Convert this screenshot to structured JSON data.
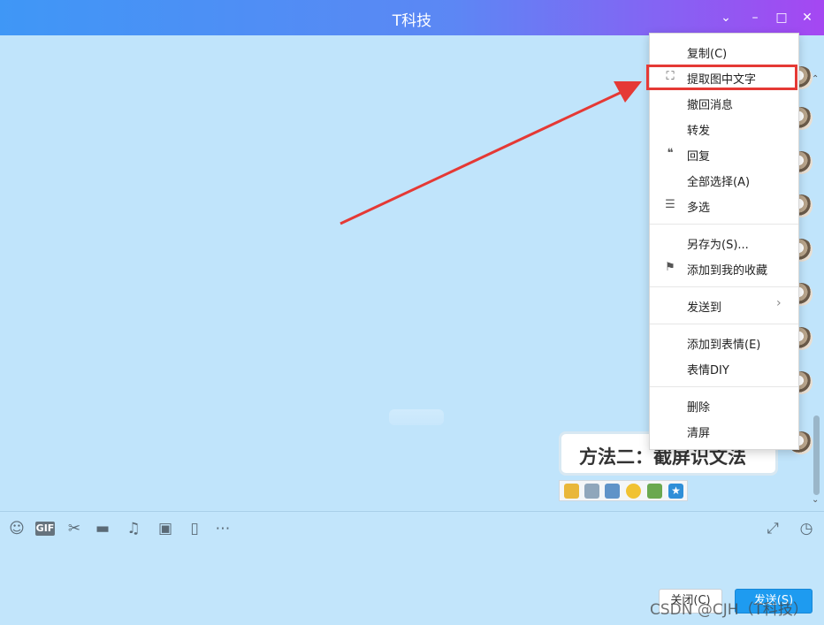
{
  "window": {
    "title": "T科技",
    "controls": [
      "chevron-down-icon",
      "minimize-icon",
      "maximize-icon",
      "close-icon"
    ]
  },
  "message": {
    "text": "方法二：截屏识文法"
  },
  "image_tools": [
    "emoji-add-icon",
    "save-icon",
    "preview-icon",
    "face-icon",
    "image-edit-icon",
    "favorite-star-icon"
  ],
  "context_menu": {
    "items": [
      {
        "label": "复制(C)",
        "icon": ""
      },
      {
        "label": "提取图中文字",
        "icon": "text-extract-icon"
      },
      {
        "label": "撤回消息",
        "icon": ""
      },
      {
        "label": "转发",
        "icon": ""
      },
      {
        "label": "回复",
        "icon": "reply-quote-icon"
      },
      {
        "label": "全部选择(A)",
        "icon": ""
      },
      {
        "label": "多选",
        "icon": "multi-select-icon"
      },
      {
        "label": "另存为(S)...",
        "icon": ""
      },
      {
        "label": "添加到我的收藏",
        "icon": "bookmark-star-icon"
      },
      {
        "label": "发送到",
        "icon": "",
        "submenu": true
      },
      {
        "label": "添加到表情(E)",
        "icon": ""
      },
      {
        "label": "表情DIY",
        "icon": ""
      },
      {
        "label": "删除",
        "icon": ""
      },
      {
        "label": "清屏",
        "icon": ""
      }
    ]
  },
  "toolbar": {
    "gif_label": "GIF",
    "icons": [
      "emoji-icon",
      "gif-icon",
      "scissors-icon",
      "folder-icon",
      "music-icon",
      "image-icon",
      "shake-icon",
      "more-icon"
    ],
    "right_icons": [
      "expand-icon",
      "history-clock-icon"
    ]
  },
  "buttons": {
    "close": "关闭(C)",
    "send": "发送(S)"
  },
  "watermark": "CSDN @CJH（T科技）",
  "colors": {
    "accent": "#1e9bf0",
    "highlight": "#e53935",
    "chat_bg": "#c0e4fb"
  }
}
